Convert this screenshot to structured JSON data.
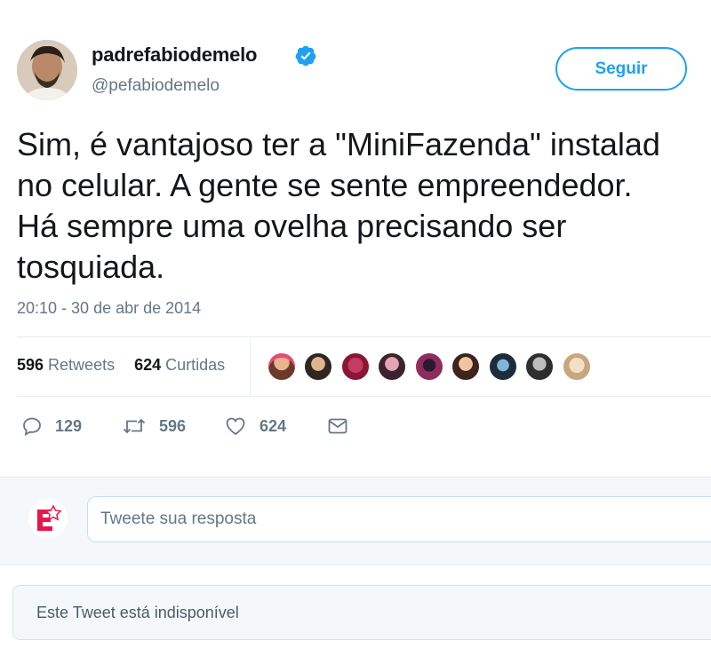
{
  "author": {
    "display_name": "padrefabiodemelo",
    "handle": "@pefabiodemelo",
    "verified_icon": "verified-badge-icon",
    "follow_label": "Seguir"
  },
  "tweet": {
    "text": "Sim, é vantajoso ter a \"MiniFazenda\" instalad\nno celular. A gente se sente empreendedor.\nHá sempre uma ovelha precisando ser\ntosquiada.",
    "timestamp": "20:10 - 30 de abr de 2014"
  },
  "stats": {
    "retweets_count": "596",
    "retweets_label": "Retweets",
    "likes_count": "624",
    "likes_label": "Curtidas",
    "liker_avatar_count": 9
  },
  "actions": {
    "reply_count": "129",
    "retweet_count": "596",
    "like_count": "624",
    "reply_icon": "reply-icon",
    "retweet_icon": "retweet-icon",
    "like_icon": "heart-icon",
    "dm_icon": "envelope-icon"
  },
  "reply_box": {
    "placeholder": "Tweete sua resposta"
  },
  "quoted": {
    "unavailable_text": "Este Tweet está indisponível"
  },
  "colors": {
    "accent": "#1da1f2",
    "text": "#14171a",
    "muted": "#657786",
    "divider": "#e6ecf0"
  }
}
